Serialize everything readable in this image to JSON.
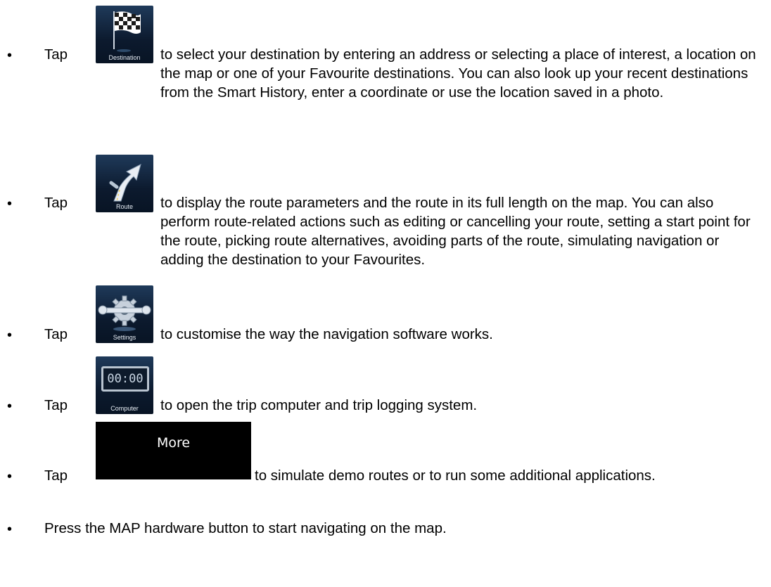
{
  "tap_word": "Tap",
  "items": [
    {
      "button_label": "Destination",
      "icon": "checkered-flag-icon",
      "text": "to select your destination by entering an address or selecting a place of interest, a location on the map or one of your Favourite destinations. You can also look up your recent destinations from the Smart History, enter a coordinate or use the location saved in a photo."
    },
    {
      "button_label": "Route",
      "icon": "route-arrow-icon",
      "text": "to display the route parameters and the route in its full length on the map. You can also perform route-related actions such as editing or cancelling your route, setting a start point for the route, picking route alternatives, avoiding parts of the route, simulating navigation or adding the destination to your Favourites."
    },
    {
      "button_label": "Settings",
      "icon": "gear-wrench-icon",
      "text": "to customise the way the navigation software works."
    },
    {
      "button_label": "Computer",
      "icon": "clock-display-icon",
      "clock_text": "00:00",
      "text": "to open the trip computer and trip logging system."
    },
    {
      "button_label": "More",
      "text": "to simulate demo routes or to run some additional applications."
    }
  ],
  "last_item": "Press the MAP hardware button to start navigating on the map."
}
